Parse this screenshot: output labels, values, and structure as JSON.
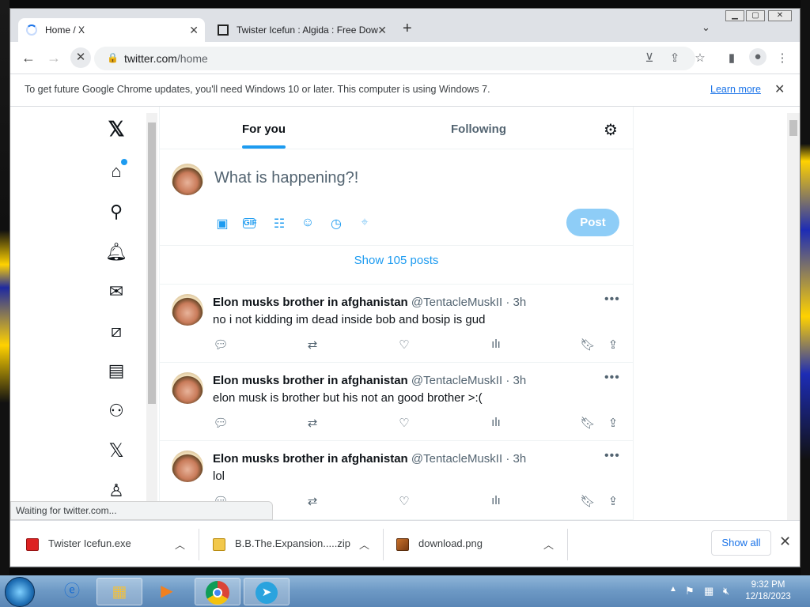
{
  "browser": {
    "tabs": [
      {
        "label": "Home / X",
        "active": true
      },
      {
        "label": "Twister Icefun : Algida : Free Dow",
        "active": false
      }
    ],
    "new_tab_icon": "plus-icon",
    "url_domain": "twitter.com",
    "url_path": "/home",
    "infobar": {
      "message": "To get future Google Chrome updates, you'll need Windows 10 or later. This computer is using Windows 7.",
      "learn_more": "Learn more"
    },
    "status_text": "Waiting for twitter.com..."
  },
  "x": {
    "tabs": {
      "for_you": "For you",
      "following": "Following"
    },
    "compose_placeholder": "What is happening?!",
    "post_button": "Post",
    "show_posts": "Show 105 posts",
    "tweets": [
      {
        "name": "Elon musks brother in afghanistan",
        "handle": "@TentacleMuskII",
        "time": "3h",
        "text": "no i not kidding im dead inside bob and bosip is gud"
      },
      {
        "name": "Elon musks brother in afghanistan",
        "handle": "@TentacleMuskII",
        "time": "3h",
        "text": "elon musk is brother but his not an good brother >:("
      },
      {
        "name": "Elon musks brother in afghanistan",
        "handle": "@TentacleMuskII",
        "time": "3h",
        "text": "lol"
      }
    ],
    "accent_color": "#1d9bf0"
  },
  "downloads": [
    {
      "name": "Twister Icefun.exe"
    },
    {
      "name": "B.B.The.Expansion.....zip"
    },
    {
      "name": "download.png"
    }
  ],
  "downloads_show_all": "Show all",
  "taskbar": {
    "time": "9:32 PM",
    "date": "12/18/2023"
  }
}
